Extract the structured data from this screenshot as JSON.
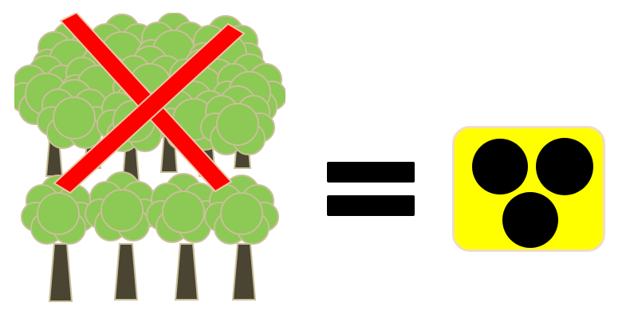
{
  "colors": {
    "background": "#ffffff",
    "foliage": "#8dc955",
    "foliage_outline": "#c9bf9a",
    "trunk": "#4a4432",
    "trunk_outline": "#c9bf9a",
    "cross": "#ff0000",
    "cross_outline": "#e9c9a8",
    "equals": "#000000",
    "sign_fill": "#ffff00",
    "sign_border": "#f2dcc4",
    "dots": "#000000"
  },
  "icons": {
    "forest": "forest-icon",
    "cross": "cross-mark-icon",
    "equals": "equals-sign-icon",
    "blind_sign": "blind-person-sign-icon"
  }
}
